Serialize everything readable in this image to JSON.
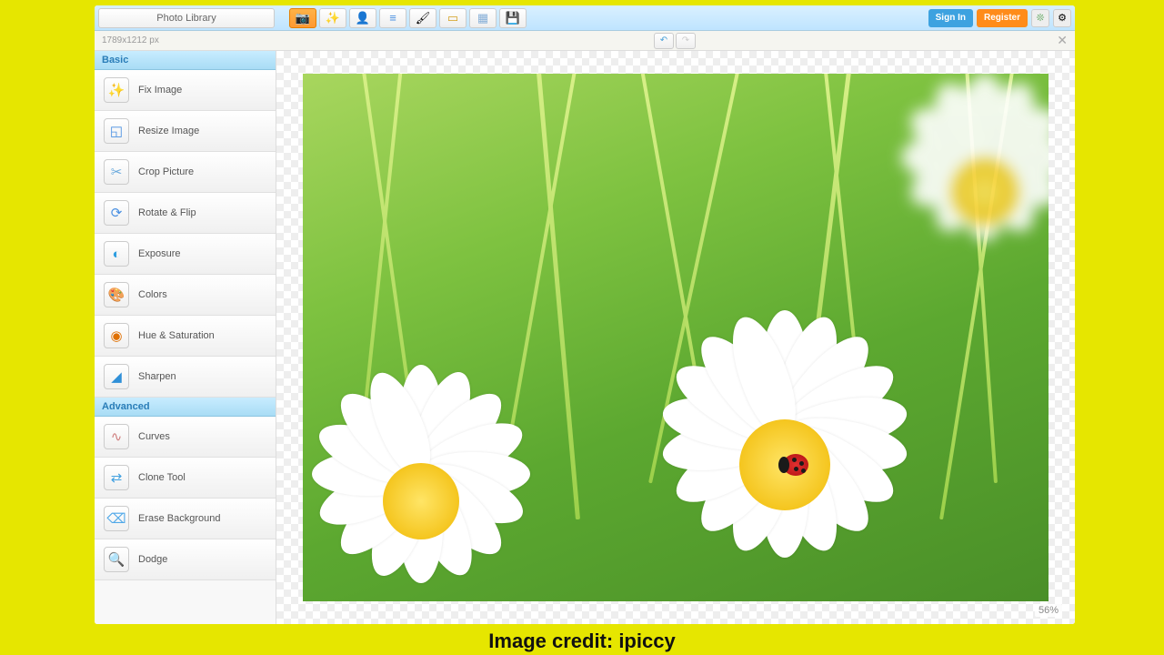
{
  "header": {
    "library_label": "Photo Library",
    "signin": "Sign In",
    "register": "Register",
    "toolbar_icons": [
      "camera",
      "magic-wand",
      "person",
      "layers",
      "paint",
      "frame",
      "texture",
      "save"
    ]
  },
  "info": {
    "dimensions": "1789x1212 px",
    "zoom": "56%"
  },
  "sidebar": {
    "basic_label": "Basic",
    "advanced_label": "Advanced",
    "basic": [
      {
        "label": "Fix Image",
        "icon": "✨",
        "color": "#f5a623"
      },
      {
        "label": "Resize Image",
        "icon": "◱",
        "color": "#4a90e2"
      },
      {
        "label": "Crop Picture",
        "icon": "✂",
        "color": "#6aa9dc"
      },
      {
        "label": "Rotate & Flip",
        "icon": "⟳",
        "color": "#4a90e2"
      },
      {
        "label": "Exposure",
        "icon": "◐",
        "color": "#2e9ee0"
      },
      {
        "label": "Colors",
        "icon": "🎨",
        "color": "#00b0f0"
      },
      {
        "label": "Hue & Saturation",
        "icon": "◉",
        "color": "#e07000"
      },
      {
        "label": "Sharpen",
        "icon": "◢",
        "color": "#3090d8"
      }
    ],
    "advanced": [
      {
        "label": "Curves",
        "icon": "∿",
        "color": "#d08080"
      },
      {
        "label": "Clone Tool",
        "icon": "⇄",
        "color": "#40a0e0"
      },
      {
        "label": "Erase Background",
        "icon": "⌫",
        "color": "#50a8e8"
      },
      {
        "label": "Dodge",
        "icon": "🔍",
        "color": "#3898e0"
      }
    ]
  },
  "credit": "Image credit: ipiccy"
}
